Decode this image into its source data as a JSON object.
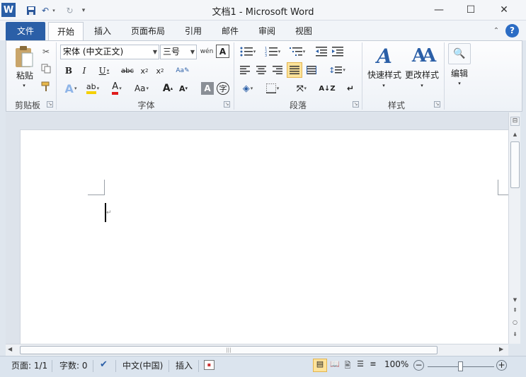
{
  "window": {
    "title": "文档1 - Microsoft Word"
  },
  "tabs": [
    "文件",
    "开始",
    "插入",
    "页面布局",
    "引用",
    "邮件",
    "审阅",
    "视图"
  ],
  "ribbon": {
    "clipboard": {
      "paste_label": "粘贴",
      "group_label": "剪贴板"
    },
    "font": {
      "font_name": "宋体 (中文正文)",
      "font_size": "三号",
      "group_label": "字体",
      "text_effect_letter": "A",
      "case_label": "Aa",
      "enclose_char": "字"
    },
    "paragraph": {
      "group_label": "段落"
    },
    "styles": {
      "quick_styles_label": "快速样式",
      "change_styles_label": "更改样式",
      "group_label": "样式"
    },
    "editing": {
      "label": "编辑"
    }
  },
  "status": {
    "page": "页面: 1/1",
    "words": "字数: 0",
    "language": "中文(中国)",
    "mode": "插入",
    "zoom": "100%"
  },
  "colors": {
    "accent": "#2b5fa7",
    "highlight": "#f5d000",
    "font_color": "#e01b1b"
  }
}
